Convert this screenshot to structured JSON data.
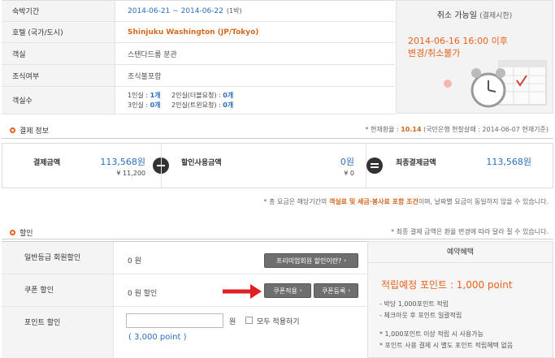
{
  "reservation": {
    "rows": [
      {
        "label": "숙박기간",
        "value": "2014-06-21 ~ 2014-06-22",
        "note": "(1박)"
      },
      {
        "label": "호텔 (국가/도시)",
        "value": "Shinjuku Washington (JP/Tokyo)"
      },
      {
        "label": "객실",
        "value": "스탠다드룸 분관"
      },
      {
        "label": "조식여부",
        "value": "조식불포함"
      },
      {
        "label": "객실수",
        "line1_a": "1인실 : ",
        "line1_b": "1개",
        "line1_c": "2인실(더블요청) : ",
        "line1_d": "0개",
        "line2_a": "3인실 : ",
        "line2_b": "0개",
        "line2_c": "2인실(트윈요청) : ",
        "line2_d": "0개"
      }
    ]
  },
  "cancel_panel": {
    "title": "취소 가능일",
    "subtitle": "(결제시한)",
    "date_line1": "2014-06-16 16:00 이후",
    "date_line2": "변경/취소불가"
  },
  "payment": {
    "section_title": "결제 정보",
    "rate_prefix": "* 현재환율 : ",
    "rate_value": "10.14",
    "rate_suffix": " (국민은행 현찰살때 : 2014-06-07 현재기준)",
    "amount_label": "결제금액",
    "amount_value": "113,568원",
    "amount_yen": "¥ 11,200",
    "discount_label": "할인사용금액",
    "discount_value": "0원",
    "discount_yen": "¥ 0",
    "final_label": "최종결제금액",
    "final_value": "113,568원",
    "note_prefix": "* 총 요금은 해당기간의 ",
    "note_highlight": "객실료 및 세금·봉사료 포함 조건",
    "note_suffix": "이며, 날짜별 요금이 동일하지 않을 수 있습니다."
  },
  "discount": {
    "section_title": "할인",
    "note": "* 최종 결제 금액은 환율 변경에 따라 달라 질 수 있습니다.",
    "member_label": "일반등급 회원할인",
    "member_value": "0 원",
    "premium_button": "프리미엄회원 할인이란?",
    "coupon_label": "쿠폰 할인",
    "coupon_value": "0 원 할인",
    "coupon_apply_button": "쿠폰적용",
    "coupon_register_button": "쿠폰등록",
    "point_label": "포인트 할인",
    "point_unit": "원",
    "point_all": "모두 적용하기",
    "point_available": "( 3,000 point )"
  },
  "benefit": {
    "title": "예약혜택",
    "points_text": "적립예정 포인트 : 1,000 point",
    "line1": "- 박당 1,000포인트 적립",
    "line2": "- 체크아웃 후 포인트 일괄적립",
    "line3": "* 1,000포인트 이상 적립 시 사용가능",
    "line4": "* 포인트 사용 결제 시 별도 포인트 적립혜택 없음"
  },
  "colors": {
    "accent": "#e8601c",
    "link_blue": "#2a6ebb",
    "arrow_red": "#e02020"
  }
}
